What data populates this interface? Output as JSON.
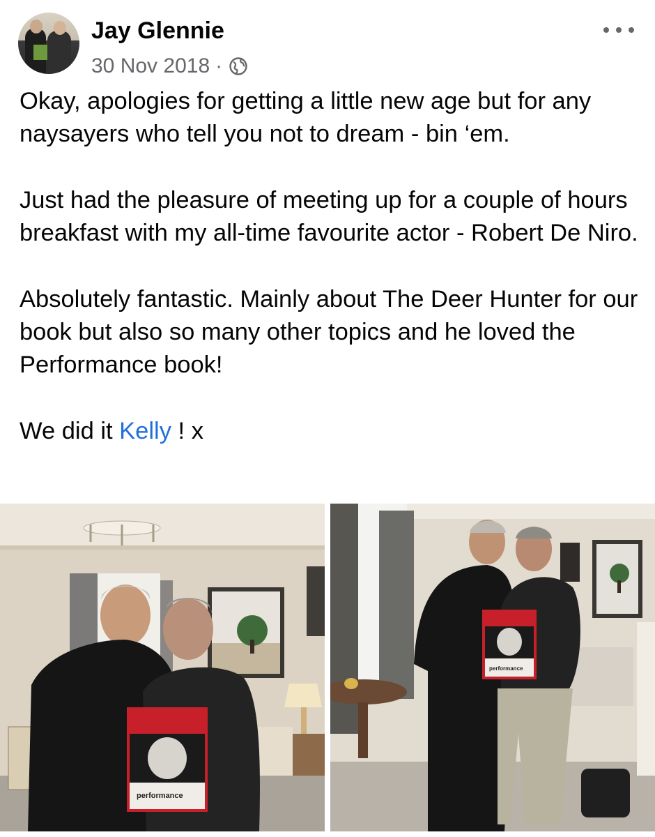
{
  "post": {
    "author": "Jay Glennie",
    "date": "30 Nov 2018",
    "separator": "·",
    "privacy_icon": "globe-icon",
    "more_icon": "more-options-icon",
    "paragraphs": [
      "Okay, apologies for getting a little new age but for any naysayers who tell you not to dream - bin ‘em.",
      "Just had the pleasure of meeting up for a couple of hours breakfast with my all-time favourite actor - Robert De Niro.",
      "Absolutely fantastic. Mainly about The Deer Hunter for our book but also so many other topics and he loved the Performance book!"
    ],
    "closing_prefix": "We did it ",
    "closing_mention": "Kelly",
    "closing_suffix": " ! x"
  },
  "photos": [
    {
      "book_title": "performance"
    },
    {
      "book_title": "performance"
    }
  ],
  "colors": {
    "mention": "#216fdb",
    "meta": "#65676b",
    "book_red": "#c8202a"
  }
}
